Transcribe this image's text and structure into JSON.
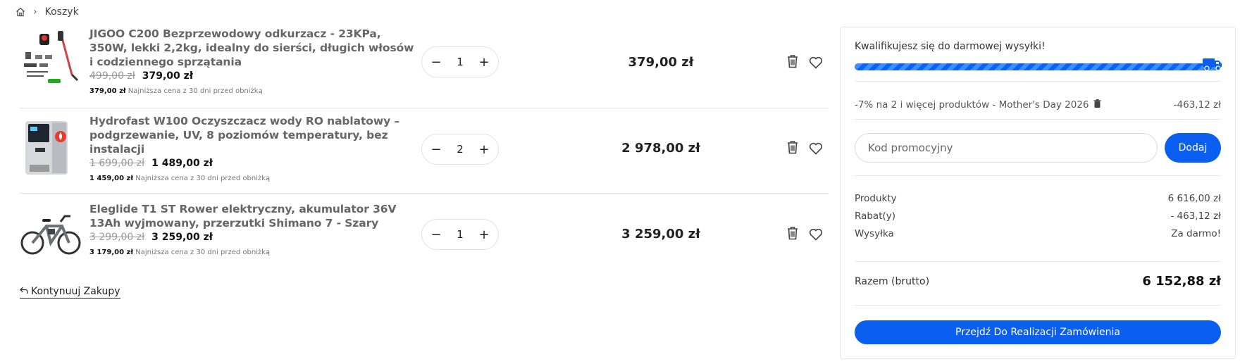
{
  "breadcrumb": {
    "home_icon": "home-icon",
    "separator": "›",
    "current": "Koszyk"
  },
  "items": [
    {
      "title": "JIGOO C200 Bezprzewodowy odkurzacz - 23KPa, 350W, lekki 2,2kg, idealny do sierści, długich włosów i codziennego sprzątania",
      "old_price": "499,00 zł",
      "price": "379,00 zł",
      "lowest_price": "379,00 zł",
      "lowest_text": "Najniższa cena z 30 dni przed obniżką",
      "qty": "1",
      "total": "379,00 zł",
      "image_icon": "vacuum-cleaner-image"
    },
    {
      "title": "Hydrofast W100 Oczyszczacz wody RO nablatowy – podgrzewanie, UV, 8 poziomów temperatury, bez instalacji",
      "old_price": "1 699,00 zł",
      "price": "1 489,00 zł",
      "lowest_price": "1 459,00 zł",
      "lowest_text": "Najniższa cena z 30 dni przed obniżką",
      "qty": "2",
      "total": "2 978,00 zł",
      "image_icon": "water-purifier-image"
    },
    {
      "title": "Eleglide T1 ST Rower elektryczny, akumulator 36V 13Ah wyjmowany, przerzutki Shimano 7 - Szary",
      "old_price": "3 299,00 zł",
      "price": "3 259,00 zł",
      "lowest_price": "3 179,00 zł",
      "lowest_text": "Najniższa cena z 30 dni przed obniżką",
      "qty": "1",
      "total": "3 259,00 zł",
      "image_icon": "electric-bike-image"
    }
  ],
  "qty_controls": {
    "minus": "−",
    "plus": "+"
  },
  "continue_link": "Kontynuuj Zakupy",
  "summary": {
    "shipping_message": "Kwalifikujesz się do darmowej wysyłki!",
    "shipping_progress": 1.0,
    "promotion_label": "-7% na 2 i więcej produktów - Mother's Day 2026",
    "promotion_value": "-463,12 zł",
    "code_placeholder": "Kod promocyjny",
    "add_label": "Dodaj",
    "products_label": "Produkty",
    "products_value": "6 616,00 zł",
    "discount_label": "Rabat(y)",
    "discount_value": "- 463,12 zł",
    "shipping_label": "Wysyłka",
    "shipping_value": "Za darmo!",
    "total_label": "Razem (brutto)",
    "total_value": "6 152,88 zł",
    "checkout_label": "Przejdź Do Realizacji Zamówienia"
  },
  "colors": {
    "accent": "#0a5ef0",
    "bar_stripe": "#3f8bff"
  }
}
